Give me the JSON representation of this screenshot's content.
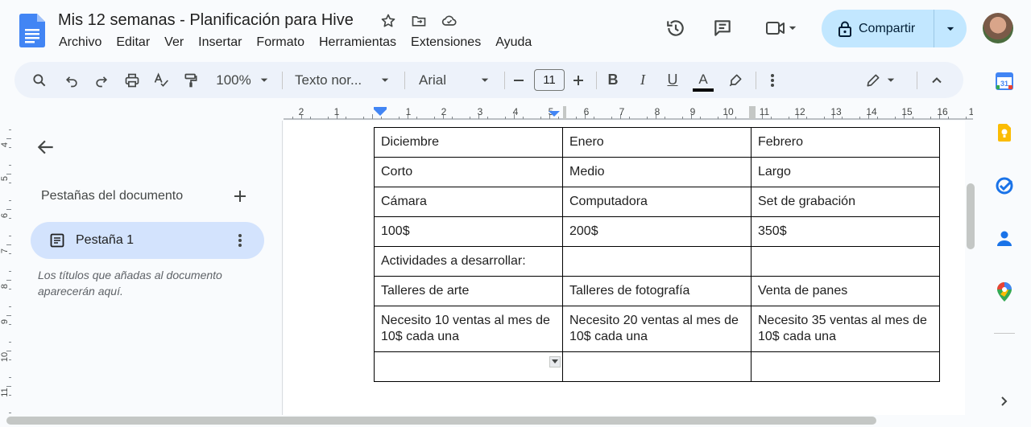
{
  "doc": {
    "title": "Mis 12 semanas - Planificación para Hive"
  },
  "menu": [
    "Archivo",
    "Editar",
    "Ver",
    "Insertar",
    "Formato",
    "Herramientas",
    "Extensiones",
    "Ayuda"
  ],
  "share": {
    "label": "Compartir"
  },
  "toolbar": {
    "zoom": "100%",
    "style": "Texto nor...",
    "font": "Arial",
    "font_size": "11"
  },
  "ruler": {
    "labels": [
      "2",
      "1",
      "1",
      "2",
      "3",
      "4",
      "5",
      "6",
      "7",
      "8",
      "9",
      "10",
      "11",
      "12",
      "13",
      "14",
      "15",
      "16",
      "1"
    ]
  },
  "vruler": {
    "labels": [
      "4",
      "5",
      "6",
      "7",
      "8",
      "9",
      "10",
      "11"
    ]
  },
  "sidebar": {
    "title": "Pestañas del documento",
    "tab_label": "Pestaña 1",
    "hint": "Los títulos que añadas al documento aparecerán aquí."
  },
  "table": {
    "rows": [
      [
        "Diciembre",
        "Enero",
        "Febrero"
      ],
      [
        "Corto",
        "Medio",
        "Largo"
      ],
      [
        "Cámara",
        "Computadora",
        "Set de grabación"
      ],
      [
        "100$",
        "200$",
        "350$"
      ],
      [
        "Actividades a desarrollar:",
        "",
        ""
      ],
      [
        "Talleres de arte",
        "Talleres de fotografía",
        "Venta de panes"
      ],
      [
        "Necesito 10 ventas al mes de 10$ cada una",
        "Necesito 20 ventas al mes de 10$ cada una",
        "Necesito 35 ventas al mes de 10$ cada una"
      ],
      [
        "",
        "",
        ""
      ]
    ]
  },
  "side_panel": {
    "icons": [
      "calendar-icon",
      "keep-icon",
      "tasks-icon",
      "contacts-icon",
      "maps-icon"
    ],
    "calendar_day": "31"
  },
  "colors": {
    "share_bg": "#c2e7ff",
    "toolbar_bg": "#edf2fa",
    "tab_active_bg": "#d3e3fd",
    "docs_blue": "#4285f4"
  }
}
